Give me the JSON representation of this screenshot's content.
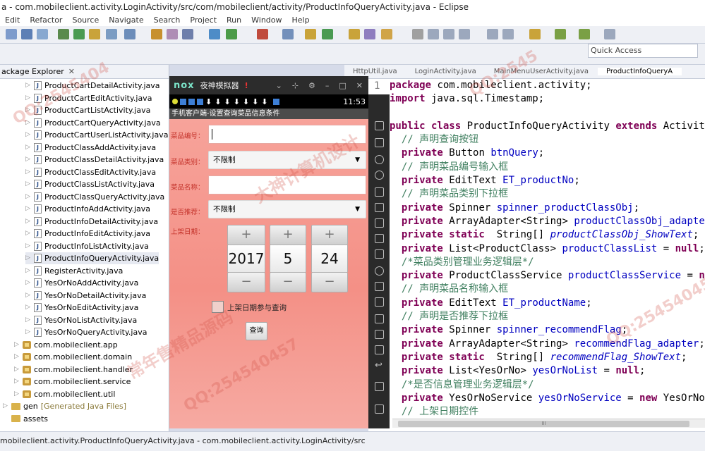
{
  "window": {
    "title": "a - com.mobileclient.activity.LoginActivity/src/com/mobileclient/activity/ProductInfoQueryActivity.java - Eclipse"
  },
  "menu": [
    "Edit",
    "Refactor",
    "Source",
    "Navigate",
    "Search",
    "Project",
    "Run",
    "Window",
    "Help"
  ],
  "quick_access": {
    "placeholder": "Quick Access"
  },
  "package_explorer": {
    "tab_label": "ackage Explorer",
    "files": [
      "ProductCartDetailActivity.java",
      "ProductCartEditActivity.java",
      "ProductCartListActivity.java",
      "ProductCartQueryActivity.java",
      "ProductCartUserListActivity.java",
      "ProductClassAddActivity.java",
      "ProductClassDetailActivity.java",
      "ProductClassEditActivity.java",
      "ProductClassListActivity.java",
      "ProductClassQueryActivity.java",
      "ProductInfoAddActivity.java",
      "ProductInfoDetailActivity.java",
      "ProductInfoEditActivity.java",
      "ProductInfoListActivity.java",
      "ProductInfoQueryActivity.java",
      "RegisterActivity.java",
      "YesOrNoAddActivity.java",
      "YesOrNoDetailActivity.java",
      "YesOrNoEditActivity.java",
      "YesOrNoListActivity.java",
      "YesOrNoQueryActivity.java"
    ],
    "packages": [
      "com.mobileclient.app",
      "com.mobileclient.domain",
      "com.mobileclient.handler",
      "com.mobileclient.service",
      "com.mobileclient.util"
    ],
    "gen_label": "gen",
    "gen_note": "[Generated Java Files]",
    "assets_label": "assets"
  },
  "emulator": {
    "title": "夜神模拟器",
    "logo": "nox",
    "clock": "11:53",
    "app_title": "手机客户端-设置查询菜品信息条件",
    "form": {
      "product_no_label": "菜品编号：",
      "product_class_label": "菜品类别：",
      "product_class_value": "不限制",
      "product_name_label": "菜品名称：",
      "recommend_label": "是否推荐：",
      "recommend_value": "不限制",
      "date_label": "上架日期：",
      "year": "2017",
      "month": "5",
      "day": "24",
      "plus": "+",
      "minus": "−",
      "checkbox_label": "上架日期参与查询",
      "query_button": "查询"
    }
  },
  "editor": {
    "tabs": [
      "HttpUtil.java",
      "LoginActivity.java",
      "MainMenuUserActivity.java",
      "ProductInfoQueryA"
    ],
    "line_number": "1"
  },
  "status_bar": {
    "text": "mobileclient.activity.ProductInfoQueryActivity.java - com.mobileclient.activity.LoginActivity/src"
  },
  "watermarks": [
    "QQ:2545404",
    "QQ:254540457",
    "QQ:2545",
    "大神计算机设计",
    "常年售精品源码",
    "QQ:25454045"
  ]
}
